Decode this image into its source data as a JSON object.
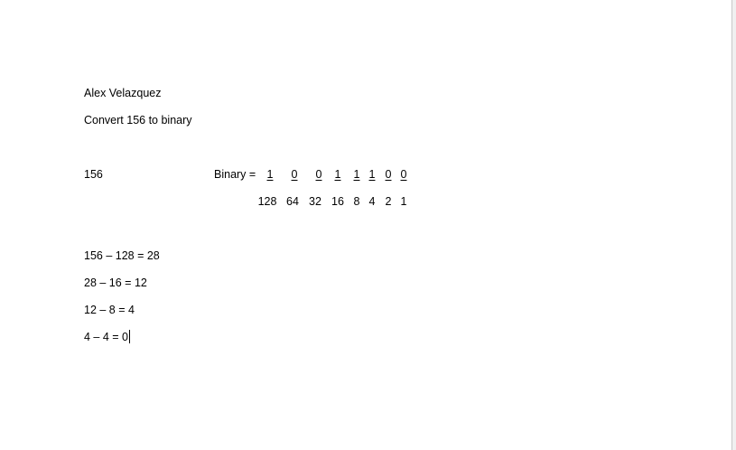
{
  "document": {
    "author": "Alex Velazquez",
    "task": "Convert 156 to binary",
    "number": "156",
    "binary_label": "Binary =",
    "bits": [
      "1",
      "0",
      "0",
      "1",
      "1",
      "1",
      "0",
      "0"
    ],
    "place_values": [
      "128",
      "64",
      "32",
      "16",
      "8",
      "4",
      "2",
      "1"
    ],
    "steps": [
      "156 – 128 = 28",
      "28 – 16 = 12",
      "12 – 8 = 4",
      "4 – 4 = 0"
    ]
  }
}
